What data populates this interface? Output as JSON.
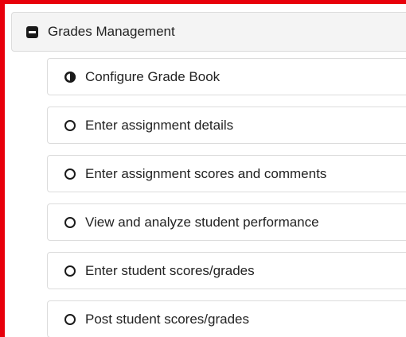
{
  "section": {
    "title": "Grades Management",
    "icon": "minus-square-icon"
  },
  "items": [
    {
      "label": "Configure Grade Book",
      "status": "in-progress",
      "icon": "half-circle-icon"
    },
    {
      "label": "Enter assignment details",
      "status": "not-started",
      "icon": "empty-circle-icon"
    },
    {
      "label": "Enter assignment scores and comments",
      "status": "not-started",
      "icon": "empty-circle-icon"
    },
    {
      "label": "View and analyze student performance",
      "status": "not-started",
      "icon": "empty-circle-icon"
    },
    {
      "label": "Enter student scores/grades",
      "status": "not-started",
      "icon": "empty-circle-icon"
    },
    {
      "label": "Post student scores/grades",
      "status": "not-started",
      "icon": "empty-circle-icon"
    }
  ],
  "colors": {
    "highlight_border": "#e8000b",
    "header_bg": "#f4f4f4",
    "item_border": "#dcdcdc"
  }
}
